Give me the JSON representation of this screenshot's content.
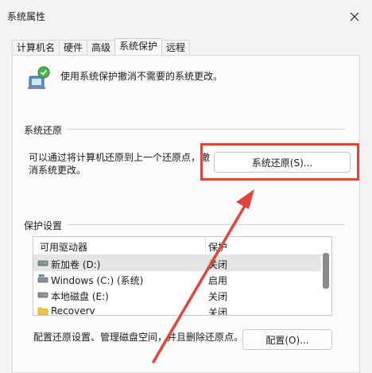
{
  "window": {
    "title": "系统属性"
  },
  "tabs": [
    {
      "label": "计算机名",
      "active": false
    },
    {
      "label": "硬件",
      "active": false
    },
    {
      "label": "高级",
      "active": false
    },
    {
      "label": "系统保护",
      "active": true
    },
    {
      "label": "远程",
      "active": false
    }
  ],
  "intro": {
    "text": "使用系统保护撤消不需要的系统更改。",
    "icon": "system-protection-icon"
  },
  "restore": {
    "group_label": "系统还原",
    "description": "可以通过将计算机还原到上一个还原点，撤消系统更改。",
    "button_label": "系统还原(S)..."
  },
  "protection": {
    "group_label": "保护设置",
    "columns": [
      "可用驱动器",
      "保护"
    ],
    "rows": [
      {
        "name": "新加卷 (D:)",
        "status": "关闭",
        "icon": "drive-icon"
      },
      {
        "name": "Windows (C:) (系统)",
        "status": "启用",
        "icon": "system-drive-icon"
      },
      {
        "name": "本地磁盘 (E:)",
        "status": "关闭",
        "icon": "drive-icon"
      },
      {
        "name": "Recoverv",
        "status": "关闭",
        "icon": "folder-icon"
      }
    ],
    "config_description": "配置还原设置、管理磁盘空间，并且删除还原点。",
    "config_button_label": "配置(O)..."
  },
  "colors": {
    "annotation": "#e0463a",
    "selected_row": "#e5e5e5"
  }
}
